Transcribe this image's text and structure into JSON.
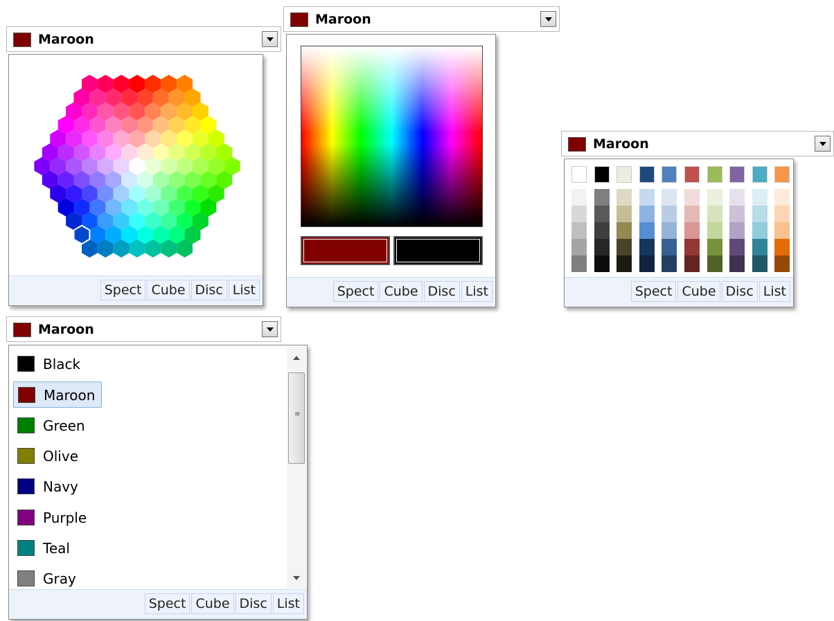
{
  "selected_color": {
    "name": "Maroon",
    "hex": "#800000"
  },
  "tab_labels": [
    "Spect",
    "Cube",
    "Disc",
    "List"
  ],
  "widgets": {
    "disc": {
      "title": "Maroon"
    },
    "spectrum": {
      "title": "Maroon",
      "new_color": "#800000",
      "old_color": "#000000"
    },
    "palette": {
      "title": "Maroon"
    },
    "list": {
      "title": "Maroon"
    }
  },
  "palette": {
    "top_row": [
      "#ffffff",
      "#000000",
      "#eeece1",
      "#1f497d",
      "#4f81bd",
      "#c0504d",
      "#9bbb59",
      "#8064a2",
      "#4bacc6",
      "#f79646"
    ],
    "shades": [
      [
        "#f2f2f2",
        "#d8d8d8",
        "#bfbfbf",
        "#a5a5a5",
        "#7f7f7f"
      ],
      [
        "#7f7f7f",
        "#595959",
        "#3f3f3f",
        "#262626",
        "#0c0c0c"
      ],
      [
        "#ddd9c3",
        "#c4bd97",
        "#938953",
        "#494429",
        "#1d1b10"
      ],
      [
        "#c6d9f0",
        "#8db3e2",
        "#548dd4",
        "#17365d",
        "#0f243e"
      ],
      [
        "#dbe5f1",
        "#b8cce4",
        "#95b3d7",
        "#366092",
        "#244061"
      ],
      [
        "#f2dcdb",
        "#e5b9b7",
        "#d99694",
        "#953734",
        "#632423"
      ],
      [
        "#ebf1dd",
        "#d7e3bc",
        "#c3d69b",
        "#76923c",
        "#4f6128"
      ],
      [
        "#e5e0ec",
        "#ccc1d9",
        "#b2a2c7",
        "#5f497a",
        "#3f3151"
      ],
      [
        "#dbeef3",
        "#b7dde8",
        "#92cddc",
        "#31859b",
        "#205867"
      ],
      [
        "#fdeada",
        "#fbd5b5",
        "#fac08f",
        "#e36c09",
        "#974806"
      ]
    ]
  },
  "list_items": [
    {
      "name": "Black",
      "hex": "#000000"
    },
    {
      "name": "Maroon",
      "hex": "#800000"
    },
    {
      "name": "Green",
      "hex": "#008000"
    },
    {
      "name": "Olive",
      "hex": "#808000"
    },
    {
      "name": "Navy",
      "hex": "#000080"
    },
    {
      "name": "Purple",
      "hex": "#800080"
    },
    {
      "name": "Teal",
      "hex": "#008080"
    },
    {
      "name": "Gray",
      "hex": "#808080"
    }
  ],
  "list_selected_index": 1
}
